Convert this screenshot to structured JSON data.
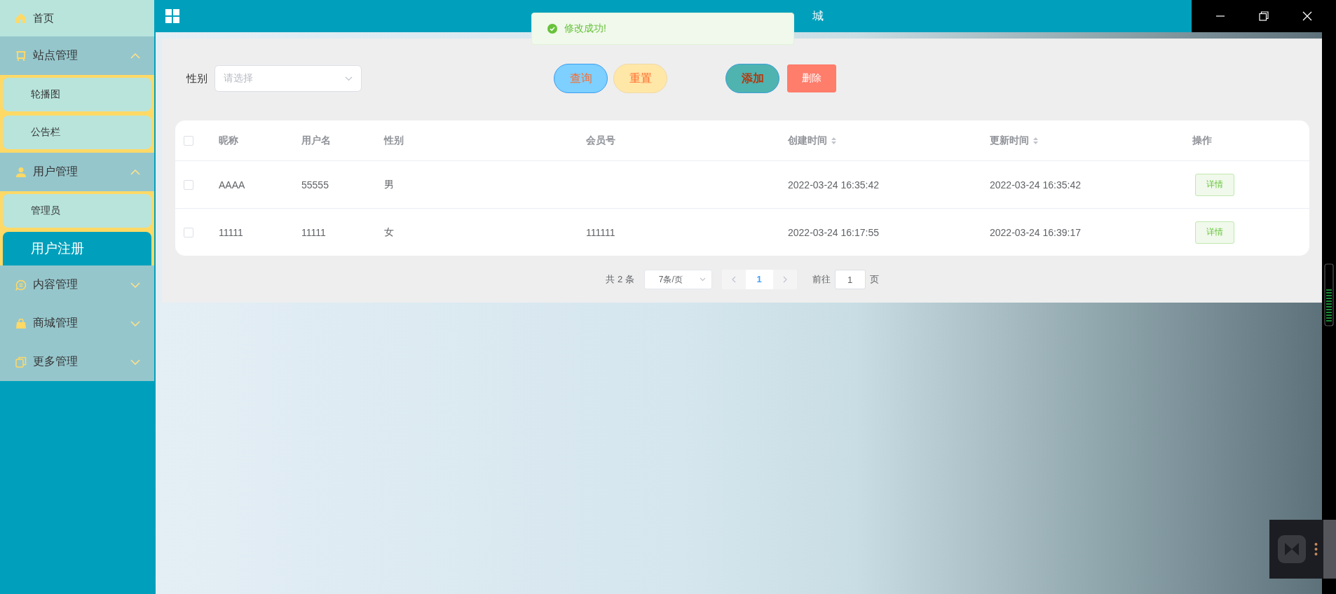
{
  "window": {
    "title": "城"
  },
  "toast": {
    "kind": "success",
    "message": "修改成功!"
  },
  "sidebar": {
    "items": [
      {
        "label": "首页"
      },
      {
        "label": "站点管理",
        "expanded": true,
        "children": [
          {
            "label": "轮播图",
            "selected": false
          },
          {
            "label": "公告栏",
            "selected": false
          }
        ]
      },
      {
        "label": "用户管理",
        "expanded": true,
        "children": [
          {
            "label": "管理员",
            "selected": false
          },
          {
            "label": "用户注册",
            "selected": true
          }
        ]
      },
      {
        "label": "内容管理",
        "expanded": false
      },
      {
        "label": "商城管理",
        "expanded": false
      },
      {
        "label": "更多管理",
        "expanded": false
      }
    ]
  },
  "filters": [
    {
      "label": "性别",
      "placeholder": "请选择"
    }
  ],
  "buttons": [
    {
      "label": "查询",
      "kind": "search"
    },
    {
      "label": "重置",
      "kind": "reset"
    },
    {
      "label": "添加",
      "kind": "add"
    },
    {
      "label": "删除",
      "kind": "delete"
    }
  ],
  "table": {
    "all_checked": false,
    "columns": [
      {
        "label": "昵称",
        "sortable": false
      },
      {
        "label": "用户名",
        "sortable": false
      },
      {
        "label": "性别",
        "sortable": false
      },
      {
        "label": "会员号",
        "sortable": false
      },
      {
        "label": "创建时间",
        "sortable": true
      },
      {
        "label": "更新时间",
        "sortable": true
      },
      {
        "label": "操作",
        "sortable": false
      }
    ],
    "rows": [
      {
        "checked": false,
        "cells": [
          "AAAA",
          "55555",
          "男",
          null,
          "2022-03-24 16:35:42",
          "2022-03-24 16:35:42"
        ],
        "action": "详情"
      },
      {
        "checked": false,
        "cells": [
          "11111",
          "11111",
          "女",
          "111111",
          "2022-03-24 16:17:55",
          "2022-03-24 16:39:17"
        ],
        "action": "详情"
      }
    ]
  },
  "pagination": {
    "total": "共 2 条",
    "page_size": "7条/页",
    "pages": [
      {
        "label": "1",
        "selected": true
      }
    ],
    "goto_label": "前往",
    "goto_value": "1",
    "goto_suffix": "页"
  }
}
